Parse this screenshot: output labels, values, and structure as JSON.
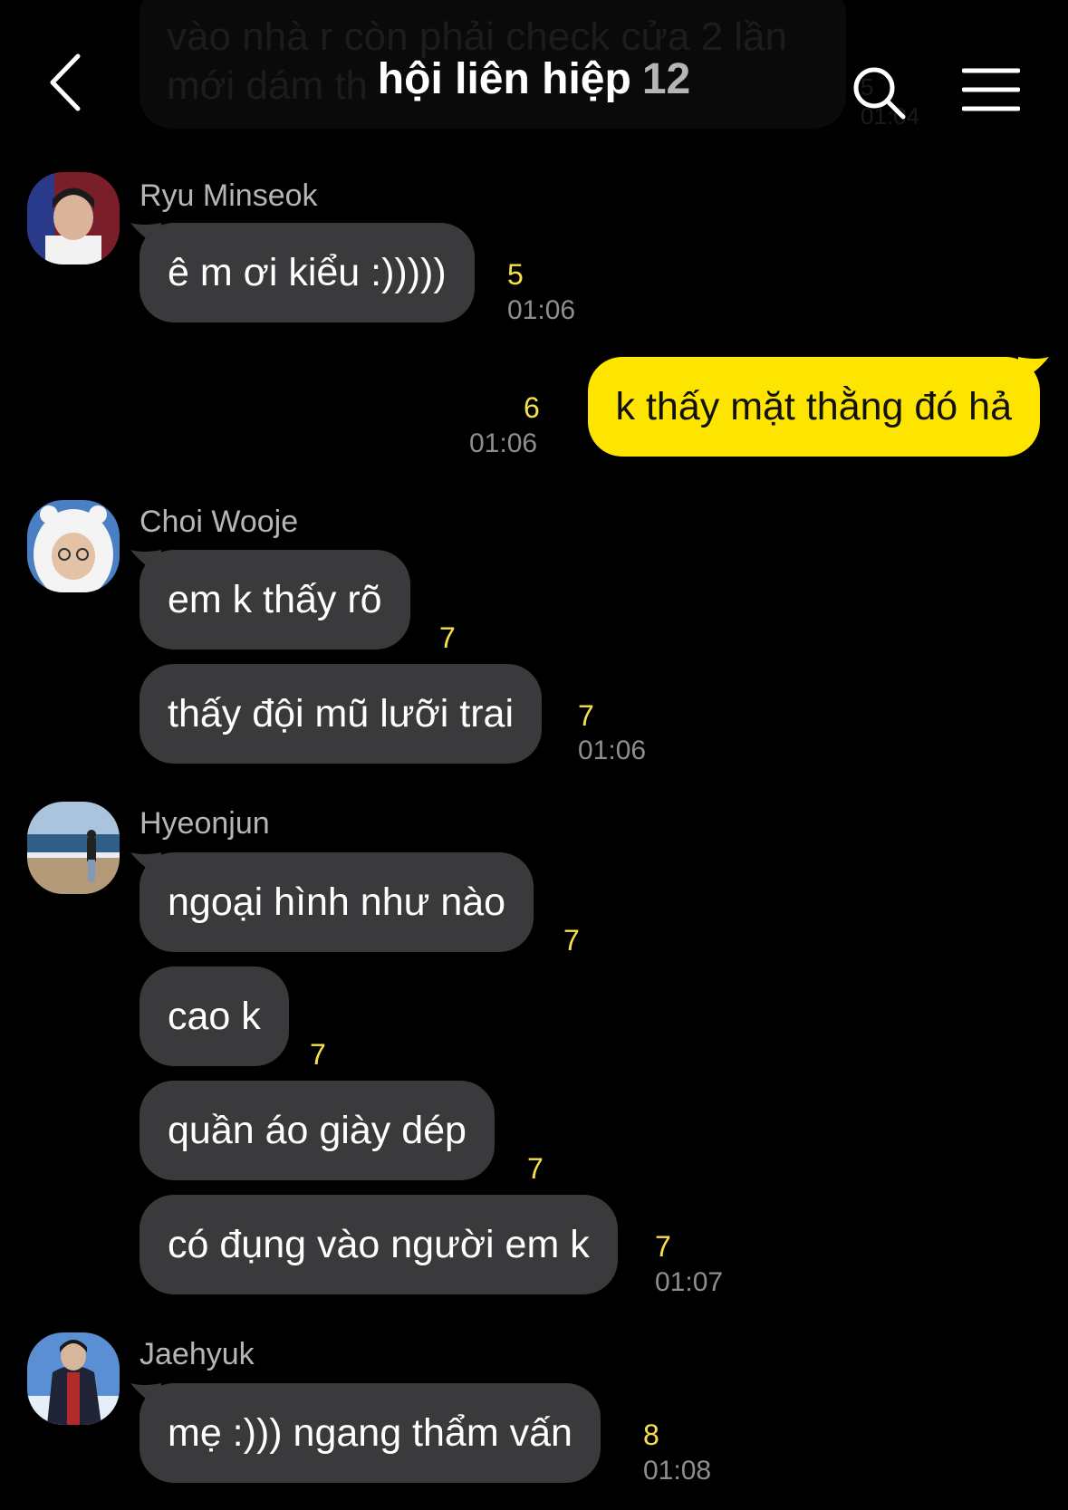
{
  "header": {
    "title": "hội liên hiệp",
    "member_count": "12",
    "back_icon": "chevron-left-icon",
    "search_icon": "search-icon",
    "menu_icon": "menu-icon"
  },
  "ghost_message": {
    "text": "vào nhà r còn phải check cửa 2 lần\nmới dám th",
    "unread": "5",
    "time": "01:04"
  },
  "messages": [
    {
      "sender": "Ryu Minseok",
      "text": "ê m ơi kiểu :)))))",
      "unread": "5",
      "time": "01:06"
    },
    {
      "sender": "me",
      "text": "k thấy mặt thằng đó hả",
      "unread": "6",
      "time": "01:06"
    },
    {
      "sender": "Choi Wooje",
      "text": "em k thấy rõ",
      "unread": "7",
      "time": ""
    },
    {
      "sender": "Choi Wooje",
      "text": "thấy đội mũ lưỡi trai",
      "unread": "7",
      "time": "01:06"
    },
    {
      "sender": "Hyeonjun",
      "text": "ngoại hình như nào",
      "unread": "7",
      "time": ""
    },
    {
      "sender": "Hyeonjun",
      "text": "cao k",
      "unread": "7",
      "time": ""
    },
    {
      "sender": "Hyeonjun",
      "text": "quần áo giày dép",
      "unread": "7",
      "time": ""
    },
    {
      "sender": "Hyeonjun",
      "text": "có đụng vào người em k",
      "unread": "7",
      "time": "01:07"
    },
    {
      "sender": "Jaehyuk",
      "text": "mẹ :))) ngang thẩm vấn",
      "unread": "8",
      "time": "01:08"
    }
  ],
  "colors": {
    "background": "#000000",
    "my_bubble": "#fee500",
    "other_bubble": "#3a3a3c",
    "unread": "#f6e14b",
    "meta": "#8e8e8e"
  }
}
